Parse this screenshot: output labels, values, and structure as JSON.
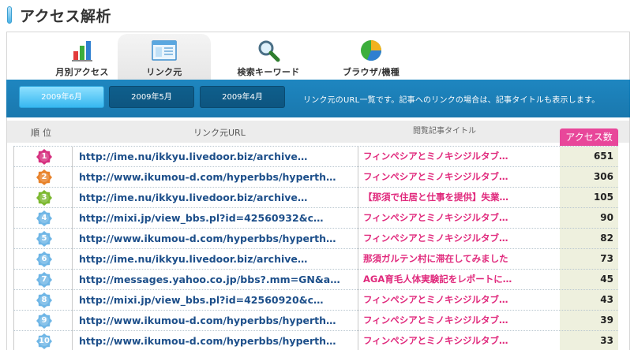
{
  "page": {
    "title": "アクセス解析"
  },
  "tabs": [
    {
      "label": "月別アクセス",
      "icon": "bar-chart-icon",
      "active": false
    },
    {
      "label": "リンク元",
      "icon": "window-icon",
      "active": true
    },
    {
      "label": "検索キーワード",
      "icon": "magnifier-icon",
      "active": false
    },
    {
      "label": "ブラウザ/機種",
      "icon": "pie-chart-icon",
      "active": false
    }
  ],
  "months": {
    "buttons": [
      {
        "label": "2009年6月",
        "active": true
      },
      {
        "label": "2009年5月",
        "active": false
      },
      {
        "label": "2009年4月",
        "active": false
      }
    ],
    "description": "リンク元のURL一覧です。記事へのリンクの場合は、記事タイトルも表示します。"
  },
  "table": {
    "headers": {
      "rank": "順位",
      "url": "リンク元URL",
      "title": "閲覧記事タイトル",
      "count": "アクセス数"
    },
    "rows": [
      {
        "rank": "1",
        "color": "#d6307f",
        "url": "http://ime.nu/ikkyu.livedoor.biz/archive…",
        "title": "フィンペシアとミノキシジルタブ…",
        "count": "651"
      },
      {
        "rank": "2",
        "color": "#e8822a",
        "url": "http://www.ikumou-d.com/hyperbbs/hyperth…",
        "title": "フィンペシアとミノキシジルタブ…",
        "count": "306"
      },
      {
        "rank": "3",
        "color": "#7cb82f",
        "url": "http://ime.nu/ikkyu.livedoor.biz/archive…",
        "title": "【那須で住居と仕事を提供】失業…",
        "count": "105"
      },
      {
        "rank": "4",
        "color": "#6fb6e6",
        "url": "http://mixi.jp/view_bbs.pl?id=42560932&c…",
        "title": "フィンペシアとミノキシジルタブ…",
        "count": "90"
      },
      {
        "rank": "5",
        "color": "#6fb6e6",
        "url": "http://www.ikumou-d.com/hyperbbs/hyperth…",
        "title": "フィンペシアとミノキシジルタブ…",
        "count": "82"
      },
      {
        "rank": "6",
        "color": "#6fb6e6",
        "url": "http://ime.nu/ikkyu.livedoor.biz/archive…",
        "title": "那須ガルテン村に滞在してみました",
        "count": "73"
      },
      {
        "rank": "7",
        "color": "#6fb6e6",
        "url": "http://messages.yahoo.co.jp/bbs?.mm=GN&a…",
        "title": "AGA育毛人体実験記をレポートに…",
        "count": "45"
      },
      {
        "rank": "8",
        "color": "#6fb6e6",
        "url": "http://mixi.jp/view_bbs.pl?id=42560920&c…",
        "title": "フィンペシアとミノキシジルタブ…",
        "count": "43"
      },
      {
        "rank": "9",
        "color": "#6fb6e6",
        "url": "http://www.ikumou-d.com/hyperbbs/hyperth…",
        "title": "フィンペシアとミノキシジルタブ…",
        "count": "39"
      },
      {
        "rank": "10",
        "color": "#6fb6e6",
        "url": "http://www.ikumou-d.com/hyperbbs/hyperth…",
        "title": "フィンペシアとミノキシジルタブ…",
        "count": "33"
      }
    ]
  },
  "colors": {
    "accent_blue": "#1a78ae",
    "count_header": "#e8479a",
    "title_pink": "#e0297c",
    "url_blue": "#1d4f8a"
  }
}
